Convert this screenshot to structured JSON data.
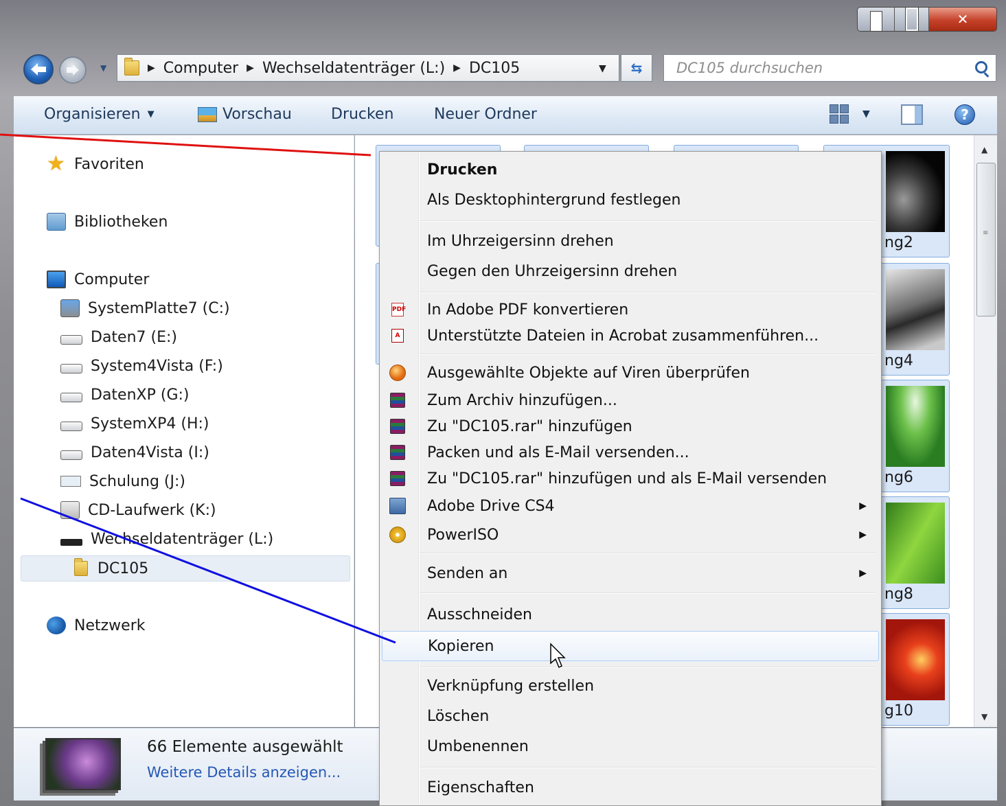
{
  "address": {
    "crumbs": [
      "Computer",
      "Wechseldatenträger (L:)",
      "DC105"
    ],
    "search_placeholder": "DC105 durchsuchen"
  },
  "toolbar": {
    "organize": "Organisieren",
    "preview": "Vorschau",
    "print": "Drucken",
    "new_folder": "Neuer Ordner"
  },
  "nav": {
    "favorites": "Favoriten",
    "libraries": "Bibliotheken",
    "computer": "Computer",
    "drives": [
      "SystemPlatte7 (C:)",
      "Daten7 (E:)",
      "System4Vista (F:)",
      "DatenXP (G:)",
      "SystemXP4 (H:)",
      "Daten4Vista (I:)",
      "Schulung (J:)",
      "CD-Laufwerk (K:)",
      "Wechseldatenträger (L:)"
    ],
    "selected_folder": "DC105",
    "network": "Netzwerk"
  },
  "files": {
    "visible_captions": [
      "ng2",
      "ng4",
      "ng6",
      "ng8",
      "g10"
    ]
  },
  "details": {
    "selection_count": "66 Elemente ausgewählt",
    "more_details": "Weitere Details anzeigen..."
  },
  "context_menu": {
    "items": [
      {
        "label": "Drucken",
        "bold": true
      },
      {
        "label": "Als Desktophintergrund festlegen"
      },
      {
        "label": "Im Uhrzeigersinn drehen"
      },
      {
        "label": "Gegen den Uhrzeigersinn drehen"
      },
      {
        "label": "In Adobe PDF konvertieren",
        "icon": "pdf-convert-icon"
      },
      {
        "label": "Unterstützte Dateien in Acrobat zusammenführen...",
        "icon": "acrobat-combine-icon"
      },
      {
        "label": "Ausgewählte Objekte auf Viren überprüfen",
        "icon": "antivirus-icon"
      },
      {
        "label": "Zum Archiv hinzufügen...",
        "icon": "winrar-icon"
      },
      {
        "label": "Zu \"DC105.rar\" hinzufügen",
        "icon": "winrar-icon"
      },
      {
        "label": "Packen und als E-Mail versenden...",
        "icon": "winrar-icon"
      },
      {
        "label": "Zu \"DC105.rar\" hinzufügen und als E-Mail versenden",
        "icon": "winrar-icon"
      },
      {
        "label": "Adobe Drive CS4",
        "icon": "adobe-drive-icon",
        "submenu": true
      },
      {
        "label": "PowerISO",
        "icon": "poweriso-icon",
        "submenu": true
      },
      {
        "label": "Senden an",
        "submenu": true
      },
      {
        "label": "Ausschneiden"
      },
      {
        "label": "Kopieren",
        "highlighted": true
      },
      {
        "label": "Verknüpfung erstellen"
      },
      {
        "label": "Löschen"
      },
      {
        "label": "Umbenennen"
      },
      {
        "label": "Eigenschaften"
      }
    ]
  },
  "colors": {
    "annotation_red": "#e01010",
    "annotation_blue": "#1010e0",
    "link_blue": "#2458b5"
  }
}
